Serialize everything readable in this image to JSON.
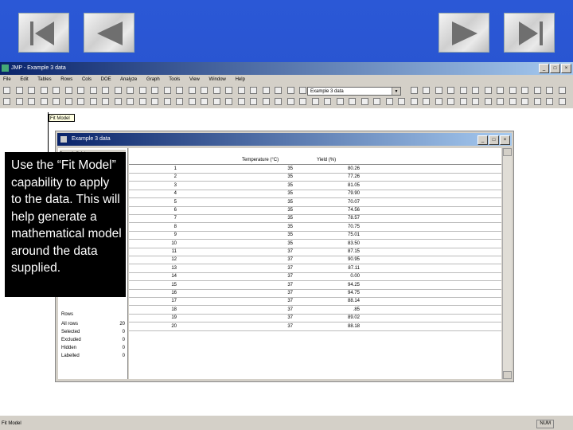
{
  "app": {
    "title": "JMP - Example 3 data",
    "menu": [
      "File",
      "Edit",
      "Tables",
      "Rows",
      "Cols",
      "DOE",
      "Analyze",
      "Graph",
      "Tools",
      "View",
      "Window",
      "Help"
    ]
  },
  "toolbar": {
    "table_combo": "Example 3 data"
  },
  "tooltip": "Fit Model",
  "callout": "Use the “Fit Model” capability to apply to the data. This will help generate a mathematical model around the data supplied.",
  "data_window": {
    "title": "Example 3 data",
    "left_panel_header": "Example 3 data",
    "rows_label": "Rows",
    "row_stats": [
      {
        "label": "All rows",
        "value": "20"
      },
      {
        "label": "Selected",
        "value": "0"
      },
      {
        "label": "Excluded",
        "value": "0"
      },
      {
        "label": "Hidden",
        "value": "0"
      },
      {
        "label": "Labelled",
        "value": "0"
      }
    ],
    "columns": [
      "Temperature (°C)",
      "Yield (%)"
    ],
    "rows": [
      {
        "n": "1",
        "t": "35",
        "y": "80.26"
      },
      {
        "n": "2",
        "t": "35",
        "y": "77.26"
      },
      {
        "n": "3",
        "t": "35",
        "y": "81.05"
      },
      {
        "n": "4",
        "t": "35",
        "y": "79.90"
      },
      {
        "n": "5",
        "t": "35",
        "y": "70.07"
      },
      {
        "n": "6",
        "t": "35",
        "y": "74.56"
      },
      {
        "n": "7",
        "t": "35",
        "y": "78.57"
      },
      {
        "n": "8",
        "t": "35",
        "y": "70.75"
      },
      {
        "n": "9",
        "t": "35",
        "y": "75.01"
      },
      {
        "n": "10",
        "t": "35",
        "y": "83.50"
      },
      {
        "n": "11",
        "t": "37",
        "y": "87.15"
      },
      {
        "n": "12",
        "t": "37",
        "y": "90.95"
      },
      {
        "n": "13",
        "t": "37",
        "y": "87.11"
      },
      {
        "n": "14",
        "t": "37",
        "y": "0.00"
      },
      {
        "n": "15",
        "t": "37",
        "y": "94.25"
      },
      {
        "n": "16",
        "t": "37",
        "y": "94.75"
      },
      {
        "n": "17",
        "t": "37",
        "y": "88.14"
      },
      {
        "n": "18",
        "t": "37",
        "y": ".85"
      },
      {
        "n": "19",
        "t": "37",
        "y": "89.02"
      },
      {
        "n": "20",
        "t": "37",
        "y": "88.18"
      }
    ]
  },
  "statusbar": {
    "left": "Fit Model",
    "right": "NUM"
  }
}
